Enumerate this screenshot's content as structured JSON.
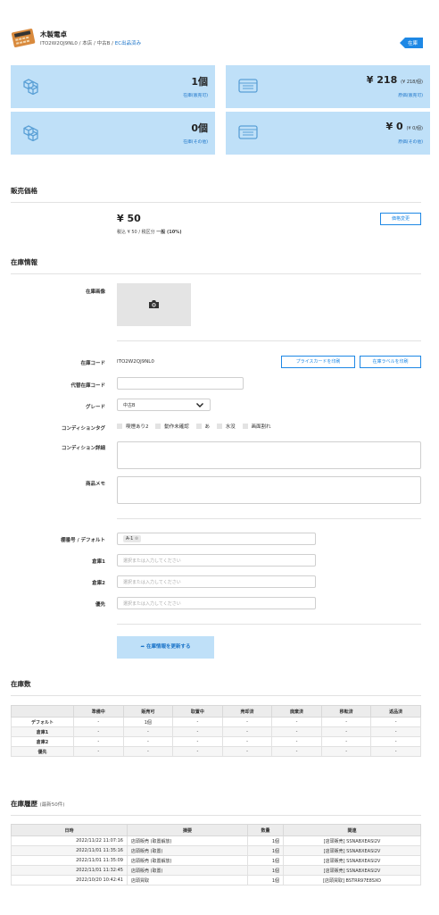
{
  "product": {
    "name": "木製電卓",
    "code": "ITO2W2QJ9NL0",
    "shop": "本店",
    "grade": "中古B",
    "ec_status": "EC出品済み",
    "badge": "在庫"
  },
  "cards": [
    {
      "icon": "boxes-icon",
      "value": "1個",
      "note": "",
      "label": "在庫(販売可)"
    },
    {
      "icon": "ledger-icon",
      "value": "¥ 218",
      "note": "(¥ 218/個)",
      "label": "原価(販売可)"
    },
    {
      "icon": "boxes-icon",
      "value": "0個",
      "note": "",
      "label": "在庫(その他)"
    },
    {
      "icon": "ledger-icon",
      "value": "¥ 0",
      "note": "(¥ 0/個)",
      "label": "原価(その他)"
    }
  ],
  "sales_price": {
    "section_title": "販売価格",
    "price": "¥ 50",
    "tax_label": "税込",
    "tax_value": "¥ 50",
    "tax_class_label": "税区分",
    "tax_class_value": "一般 (10%)",
    "change_button": "価格変更"
  },
  "stock_info": {
    "section_title": "在庫情報",
    "image_label": "在庫画像",
    "code_label": "在庫コード",
    "code_value": "ITO2W2QJ9NL0",
    "print_price_card": "プライスカードを印刷",
    "print_stock_label": "在庫ラベルを印刷",
    "alt_code_label": "代替在庫コード",
    "alt_code_value": "",
    "grade_label": "グレード",
    "grade_value": "中古B",
    "condition_tag_label": "コンディションタグ",
    "condition_tags": [
      "喫煙あり2",
      "動作未確認",
      "あ",
      "水没",
      "画面割れ"
    ],
    "condition_detail_label": "コンディション詳細",
    "memo_label": "商品メモ",
    "shelf_default_label": "棚番号 / デフォルト",
    "shelf_default_chip": "A-1",
    "warehouse1_label": "倉庫1",
    "warehouse2_label": "倉庫2",
    "priority_label": "優先",
    "select_placeholder": "選択または入力してください",
    "update_button": "在庫情報を更新する"
  },
  "stock_count": {
    "section_title": "在庫数",
    "columns": [
      "",
      "準備中",
      "販売可",
      "取置中",
      "売却済",
      "廃棄済",
      "移転済",
      "返品済"
    ],
    "rows": [
      [
        "デフォルト",
        "-",
        "1個",
        "-",
        "-",
        "-",
        "-",
        "-"
      ],
      [
        "倉庫1",
        "-",
        "-",
        "-",
        "-",
        "-",
        "-",
        "-"
      ],
      [
        "倉庫2",
        "-",
        "-",
        "-",
        "-",
        "-",
        "-",
        "-"
      ],
      [
        "優先",
        "-",
        "-",
        "-",
        "-",
        "-",
        "-",
        "-"
      ]
    ]
  },
  "history": {
    "section_title": "在庫履歴",
    "section_note": "(最新50件)",
    "columns": [
      "日時",
      "摘要",
      "数量",
      "関連"
    ],
    "rows": [
      [
        "2022/11/22 11:07:16",
        "店頭販売 (取置解放)",
        "1個",
        "[店頭販売] SSNABXEASI2V"
      ],
      [
        "2022/11/01 11:35:16",
        "店頭販売 (取置)",
        "1個",
        "[店頭販売] SSNABXEASI2V"
      ],
      [
        "2022/11/01 11:35:09",
        "店頭販売 (取置解放)",
        "1個",
        "[店頭販売] SSNABXEASI2V"
      ],
      [
        "2022/11/01 11:32:45",
        "店頭販売 (取置)",
        "1個",
        "[店頭販売] SSNABXEASI2V"
      ],
      [
        "2022/10/20 10:42:41",
        "店頭買取",
        "1個",
        "[店頭買取] BSTRR97E8SXO"
      ]
    ]
  },
  "colors": {
    "accent": "#1e88e5",
    "card_bg": "#bfe0f8",
    "link": "#1a73c8"
  }
}
